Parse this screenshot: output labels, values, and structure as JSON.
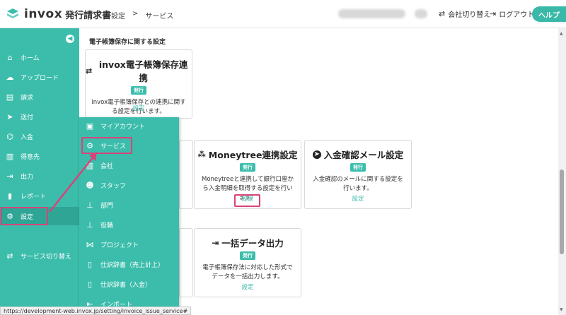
{
  "header": {
    "logo_text": "invox",
    "logo_sub": "発行請求書",
    "breadcrumb": [
      "設定",
      "サービス"
    ],
    "switch_company": "会社切り替え",
    "logout": "ログアウト",
    "help": "ヘルプ"
  },
  "sidebar": {
    "items": [
      {
        "label": "ホーム",
        "icon": "home-icon"
      },
      {
        "label": "アップロード",
        "icon": "upload-icon"
      },
      {
        "label": "請求",
        "icon": "document-icon"
      },
      {
        "label": "送付",
        "icon": "send-icon"
      },
      {
        "label": "入金",
        "icon": "bank-icon"
      },
      {
        "label": "得意先",
        "icon": "building-icon"
      },
      {
        "label": "出力",
        "icon": "export-icon"
      },
      {
        "label": "レポート",
        "icon": "chart-icon"
      },
      {
        "label": "設定",
        "icon": "gear-icon"
      },
      {
        "label": "サービス切り替え",
        "icon": "switch-icon"
      }
    ]
  },
  "flyout": {
    "items": [
      {
        "label": "マイアカウント",
        "icon": "account-icon"
      },
      {
        "label": "サービス",
        "icon": "gears-icon"
      },
      {
        "label": "会社",
        "icon": "company-icon"
      },
      {
        "label": "スタッフ",
        "icon": "users-icon"
      },
      {
        "label": "部門",
        "icon": "org-icon"
      },
      {
        "label": "役職",
        "icon": "org-icon"
      },
      {
        "label": "プロジェクト",
        "icon": "project-icon"
      },
      {
        "label": "仕訳辞書（売上計上）",
        "icon": "book-icon"
      },
      {
        "label": "仕訳辞書（入金）",
        "icon": "book-icon"
      },
      {
        "label": "インポート",
        "icon": "import-icon"
      }
    ]
  },
  "main": {
    "section_title": "電子帳簿保存に関する設定",
    "badge": "発行",
    "setting_link": "設定",
    "cards": [
      {
        "title": "invox電子帳簿保存連携",
        "desc": "invox電子帳簿保存との連携に関する設定を行います。"
      },
      {
        "title": "Moneytree連携設定",
        "desc": "Moneytreeと連携して銀行口座から入金明細を取得する設定を行います。"
      },
      {
        "title": "入金確認メール設定",
        "desc": "入金確認のメールに関する設定を行います。"
      },
      {
        "title": "一括データ出力",
        "desc": "電子帳簿保存法に対応した形式でデータを一括出力します。"
      }
    ]
  },
  "status_url": "https://development-web.invox.jp/setting/invoice_issue_service#",
  "colors": {
    "accent": "#3cbdab",
    "highlight": "#d8437a"
  }
}
